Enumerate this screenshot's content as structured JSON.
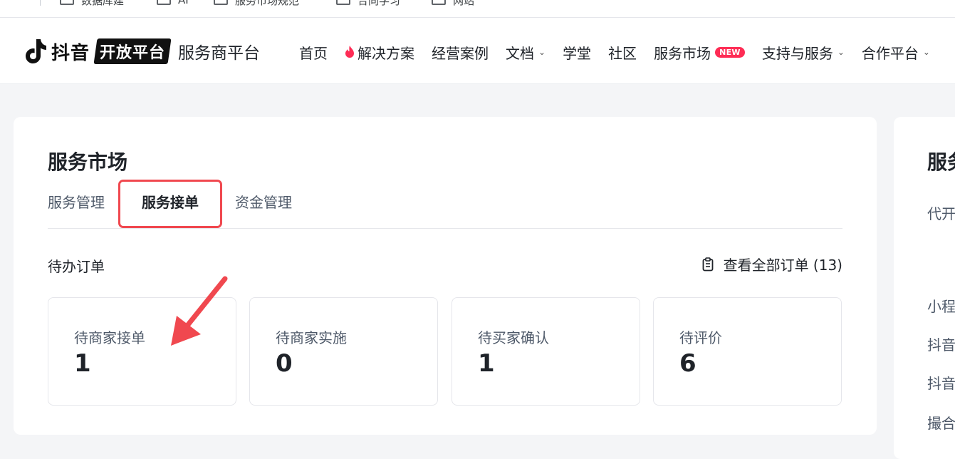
{
  "bookmarks": [
    "数据库建",
    "AI",
    "服务市场规范",
    "合同学习",
    "网站"
  ],
  "header": {
    "brand": "抖音",
    "brand_badge": "开放平台",
    "subtitle": "服务商平台",
    "nav": [
      {
        "label": "首页",
        "dropdown": false
      },
      {
        "label": "解决方案",
        "icon": "fire-icon",
        "dropdown": false
      },
      {
        "label": "经营案例",
        "dropdown": false
      },
      {
        "label": "文档",
        "dropdown": true
      },
      {
        "label": "学堂",
        "dropdown": false
      },
      {
        "label": "社区",
        "dropdown": false
      },
      {
        "label": "服务市场",
        "badge": "NEW",
        "dropdown": false
      },
      {
        "label": "支持与服务",
        "dropdown": true
      },
      {
        "label": "合作平台",
        "dropdown": true
      }
    ]
  },
  "market": {
    "title": "服务市场",
    "tabs": [
      {
        "label": "服务管理",
        "active": false
      },
      {
        "label": "服务接单",
        "active": true
      },
      {
        "label": "资金管理",
        "active": false
      }
    ],
    "pending_label": "待办订单",
    "view_all": "查看全部订单 (13)",
    "stats": [
      {
        "label": "待商家接单",
        "value": "1"
      },
      {
        "label": "待商家实施",
        "value": "0"
      },
      {
        "label": "待买家确认",
        "value": "1"
      },
      {
        "label": "待评价",
        "value": "6"
      }
    ]
  },
  "side_card": {
    "title": "服务",
    "items": [
      "代开",
      "小程",
      "抖音",
      "抖音",
      "撮合"
    ]
  },
  "colors": {
    "brand_red": "#fe2c55",
    "highlight": "#f0484f",
    "text": "#1f2329",
    "muted": "#4e5969"
  }
}
